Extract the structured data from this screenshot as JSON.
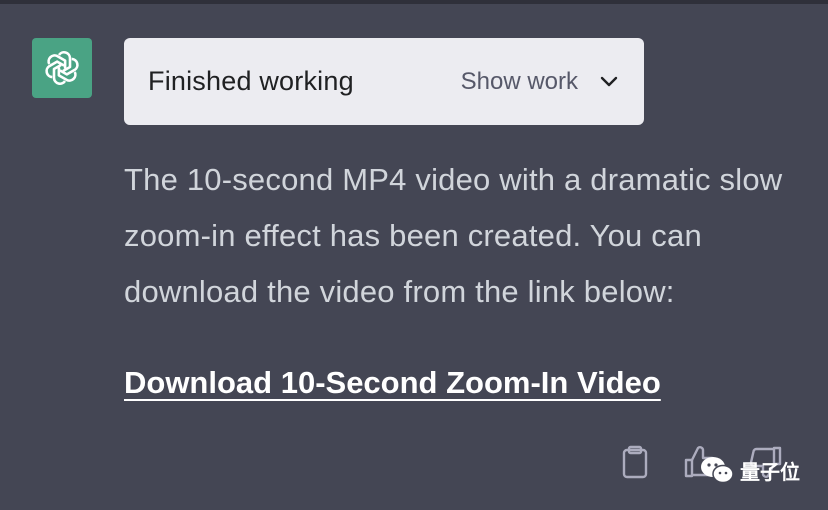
{
  "assistant": {
    "avatar_icon": "openai-logo-icon",
    "avatar_color": "#4aa384"
  },
  "work_card": {
    "status": "Finished working",
    "toggle_label": "Show work",
    "toggle_icon": "chevron-down-icon"
  },
  "message": {
    "text": "The 10-second MP4 video with a dramatic slow zoom-in effect has been created. You can download the video from the link below:",
    "link_text": "Download 10-Second Zoom-In Video"
  },
  "actions": {
    "copy_icon": "clipboard-icon",
    "thumbs_up_icon": "thumbs-up-icon",
    "thumbs_down_icon": "thumbs-down-icon"
  },
  "watermark": {
    "text": "量子位",
    "logo_icon": "wechat-logo-icon"
  },
  "colors": {
    "background": "#444654",
    "card_background": "#ececf1",
    "body_text": "#d1d5db",
    "link_text": "#ffffff"
  }
}
